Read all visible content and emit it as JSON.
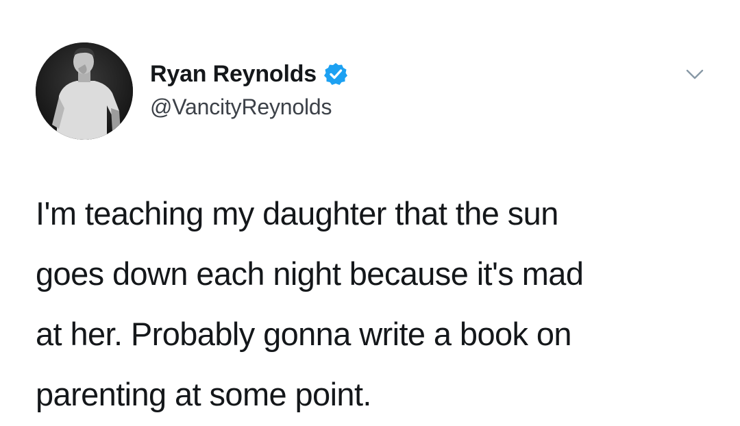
{
  "author": {
    "display_name": "Ryan Reynolds",
    "handle": "@VancityReynolds",
    "verified": true,
    "avatar_icon": "profile-photo"
  },
  "tweet": {
    "lines": [
      "I'm teaching my daughter that the sun",
      "goes down each night because it's mad",
      "at her. Probably gonna write a book on",
      "parenting at some point."
    ]
  },
  "icons": {
    "verified_badge": "verified-check-icon",
    "menu": "chevron-down-icon"
  },
  "colors": {
    "verified_blue": "#1da1f2",
    "text": "#14171a",
    "handle_gray": "#3c4148",
    "chevron_gray": "#8899a6"
  }
}
